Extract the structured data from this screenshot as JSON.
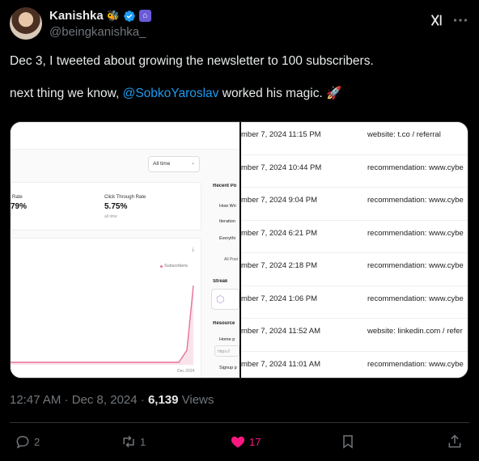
{
  "author": {
    "display_name": "Kanishka",
    "name_emoji": "🐝",
    "handle": "@beingkanishka_"
  },
  "tweet": {
    "line1": "Dec 3, I tweeted about growing the newsletter to 100 subscribers.",
    "line2_prefix": "next thing we know, ",
    "mention": "@SobkoYaroslav",
    "line2_suffix": " worked his magic. 🚀"
  },
  "media": {
    "left": {
      "filter_select": "All time",
      "stat_a_label": "Rate",
      "stat_a_value": "79%",
      "stat_b_label": "Click Through Rate",
      "stat_b_value": "5.75%",
      "stat_b_sub": "all time",
      "legend": "Subscribers",
      "x_tick": "Dec 2024",
      "side": {
        "recent_posts": "Recent Po",
        "post1": "How Wri",
        "post2": "Iteration",
        "post3": "Everythi",
        "all_posts": "All Post",
        "streak": "Streak",
        "resources": "Resource",
        "home": "Home p",
        "home_url": "https://",
        "signup": "Signup p"
      }
    },
    "rows": [
      {
        "date": "mber 7, 2024 11:15 PM",
        "source": "website: t.co / referral"
      },
      {
        "date": "mber 7, 2024 10:44 PM",
        "source": "recommendation: www.cybe"
      },
      {
        "date": "mber 7, 2024 9:04 PM",
        "source": "recommendation: www.cybe"
      },
      {
        "date": "mber 7, 2024 6:21 PM",
        "source": "recommendation: www.cybe"
      },
      {
        "date": "mber 7, 2024 2:18 PM",
        "source": "recommendation: www.cybe"
      },
      {
        "date": "mber 7, 2024 1:06 PM",
        "source": "recommendation: www.cybe"
      },
      {
        "date": "mber 7, 2024 11:52 AM",
        "source": "website: linkedin.com / refer"
      },
      {
        "date": "mber 7, 2024 11:01 AM",
        "source": "recommendation: www.cybe"
      }
    ]
  },
  "meta": {
    "time": "12:47 AM · Dec 8, 2024 · ",
    "views_count": "6,139",
    "views_label": " Views"
  },
  "actions": {
    "replies": "2",
    "reposts": "1",
    "likes": "17"
  },
  "colors": {
    "background": "#000000",
    "text": "#e7e9ea",
    "muted": "#71767b",
    "link": "#1d9bf0",
    "like": "#f91880",
    "verified": "#1d9bf0",
    "chart_line": "#e57399"
  }
}
